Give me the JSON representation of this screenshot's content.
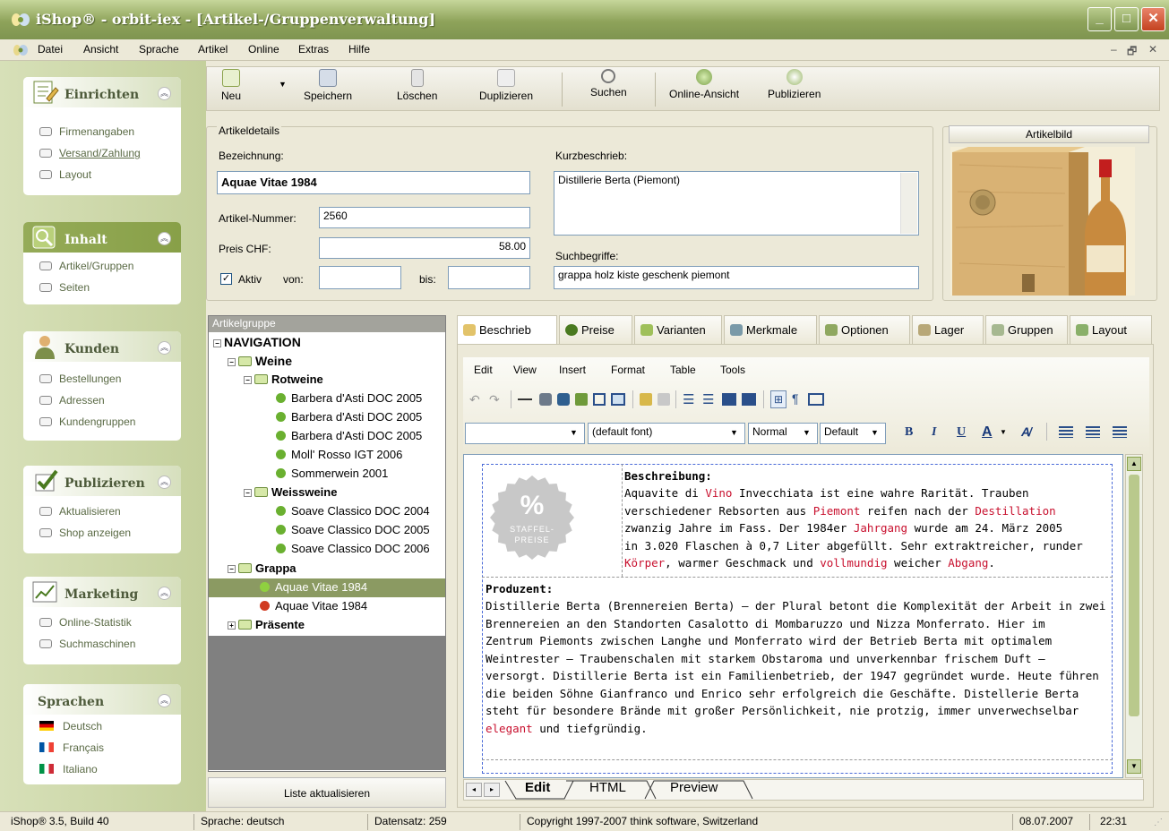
{
  "window": {
    "title": "iShop® - orbit-iex - [Artikel-/Gruppenverwaltung]",
    "min": "_",
    "max": "□",
    "close": "✕"
  },
  "menu": [
    "Datei",
    "Ansicht",
    "Sprache",
    "Artikel",
    "Online",
    "Extras",
    "Hilfe"
  ],
  "mdi": {
    "min": "–",
    "restore": "🗗",
    "close": "✕"
  },
  "sidebar": {
    "einrichten": {
      "title": "Einrichten",
      "items": [
        "Firmenangaben",
        "Versand/Zahlung",
        "Layout"
      ]
    },
    "inhalt": {
      "title": "Inhalt",
      "items": [
        "Artikel/Gruppen",
        "Seiten"
      ]
    },
    "kunden": {
      "title": "Kunden",
      "items": [
        "Bestellungen",
        "Adressen",
        "Kundengruppen"
      ]
    },
    "publizieren": {
      "title": "Publizieren",
      "items": [
        "Aktualisieren",
        "Shop anzeigen"
      ]
    },
    "marketing": {
      "title": "Marketing",
      "items": [
        "Online-Statistik",
        "Suchmaschinen"
      ]
    },
    "sprachen": {
      "title": "Sprachen",
      "items": [
        "Deutsch",
        "Français",
        "Italiano"
      ]
    }
  },
  "toolbar": {
    "neu": "Neu",
    "speichern": "Speichern",
    "loeschen": "Löschen",
    "duplizieren": "Duplizieren",
    "suchen": "Suchen",
    "online": "Online-Ansicht",
    "publizieren": "Publizieren"
  },
  "artikeldetails": {
    "legend": "Artikeldetails",
    "bezeichnung_label": "Bezeichnung:",
    "bezeichnung": "Aquae Vitae 1984",
    "nummer_label": "Artikel-Nummer:",
    "nummer": "2560",
    "preis_label": "Preis CHF:",
    "preis": "58.00",
    "aktiv_label": "Aktiv",
    "von_label": "von:",
    "bis_label": "bis:",
    "kurz_label": "Kurzbeschrieb:",
    "kurz": "Distillerie Berta (Piemont)",
    "such_label": "Suchbegriffe:",
    "such": "grappa holz kiste geschenk piemont"
  },
  "artikelbild": {
    "title": "Artikelbild"
  },
  "tree": {
    "header": "Artikelgruppe",
    "navigation": "NAVIGATION",
    "weine": "Weine",
    "rotweine": "Rotweine",
    "rot": [
      "Barbera d'Asti DOC 2005",
      "Barbera d'Asti DOC 2005",
      "Barbera d'Asti DOC 2005",
      "Moll' Rosso IGT 2006",
      "Sommerwein 2001"
    ],
    "weissweine": "Weissweine",
    "weiss": [
      "Soave Classico DOC 2004",
      "Soave Classico DOC 2005",
      "Soave Classico DOC 2006"
    ],
    "grappa": "Grappa",
    "grappa_items": [
      "Aquae Vitae 1984",
      "Aquae Vitae 1984"
    ],
    "praesente": "Präsente",
    "refresh": "Liste aktualisieren"
  },
  "tabs": [
    "Beschrieb",
    "Preise",
    "Varianten",
    "Merkmale",
    "Optionen",
    "Lager",
    "Gruppen",
    "Layout"
  ],
  "editor": {
    "menu": [
      "Edit",
      "View",
      "Insert",
      "Format",
      "Table",
      "Tools"
    ],
    "font": "(default font)",
    "style": "Normal",
    "size": "Default",
    "bold": "B",
    "italic": "I",
    "underline": "U",
    "color": "A",
    "badge_pct": "%",
    "badge_l1": "STAFFEL-",
    "badge_l2": "PREISE",
    "h1": "Beschreibung:",
    "p1": [
      [
        {
          "t": "Aquavite di "
        },
        {
          "t": "Vino",
          "r": 1
        },
        {
          "t": " Invecchiata ist eine wahre Rarität. Trauben"
        }
      ],
      [
        {
          "t": "verschiedener Rebsorten aus "
        },
        {
          "t": "Piemont",
          "r": 1
        },
        {
          "t": " reifen nach der "
        },
        {
          "t": "Destillation",
          "r": 1
        }
      ],
      [
        {
          "t": "zwanzig Jahre im Fass. Der 1984er "
        },
        {
          "t": "Jahrgang",
          "r": 1
        },
        {
          "t": " wurde am 24. März 2005"
        }
      ],
      [
        {
          "t": "in 3.020 Flaschen à 0,7 Liter abgefüllt. Sehr extraktreicher, runder"
        }
      ],
      [
        {
          "t": "Körper",
          "r": 1
        },
        {
          "t": ", warmer Geschmack und "
        },
        {
          "t": "vollmundig",
          "r": 1
        },
        {
          "t": " weicher "
        },
        {
          "t": "Abgang",
          "r": 1
        },
        {
          "t": "."
        }
      ]
    ],
    "h2": "Produzent:",
    "p2": [
      [
        {
          "t": "Distillerie Berta (Brennereien Berta) – der Plural betont die Komplexität der Arbeit in zwei"
        }
      ],
      [
        {
          "t": "Brennereien an den Standorten Casalotto di Mombaruzzo und Nizza Monferrato. Hier im"
        }
      ],
      [
        {
          "t": "Zentrum Piemonts zwischen Langhe und Monferrato wird der Betrieb Berta mit optimalem"
        }
      ],
      [
        {
          "t": "Weintrester – Traubenschalen mit starkem Obstaroma und unverkennbar frischem Duft –"
        }
      ],
      [
        {
          "t": "versorgt. Distillerie Berta ist ein Familienbetrieb, der 1947 gegründet wurde. Heute führen"
        }
      ],
      [
        {
          "t": "die beiden Söhne Gianfranco und Enrico sehr erfolgreich die Geschäfte. Distellerie Berta"
        }
      ],
      [
        {
          "t": "steht für besondere Brände mit großer Persönlichkeit, nie protzig, immer unverwechselbar"
        }
      ],
      [
        {
          "t": "elegant",
          "r": 1
        },
        {
          "t": " und tiefgründig."
        }
      ]
    ],
    "bottom_tabs": [
      "Edit",
      "HTML",
      "Preview"
    ]
  },
  "status": {
    "version": "iShop® 3.5, Build 40",
    "sprache": "Sprache: deutsch",
    "datensatz": "Datensatz: 259",
    "copyright": "Copyright 1997-2007 think software, Switzerland",
    "date": "08.07.2007",
    "time": "22:31"
  },
  "colors": {
    "titlebar": "#8ea35a",
    "accent_green": "#8aa24b",
    "link_red": "#c8102e",
    "selection": "#8b9a62"
  }
}
